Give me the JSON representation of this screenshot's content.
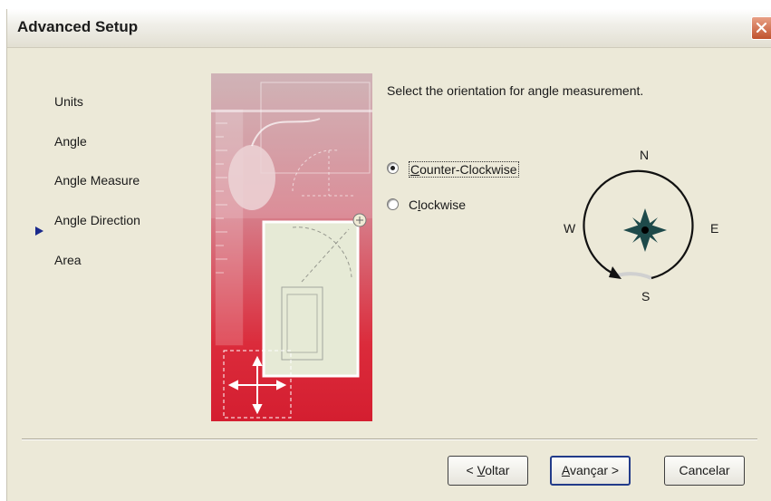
{
  "window": {
    "title": "Advanced Setup"
  },
  "steps": [
    {
      "label": "Units"
    },
    {
      "label": "Angle"
    },
    {
      "label": "Angle Measure"
    },
    {
      "label": "Angle Direction",
      "current": true
    },
    {
      "label": "Area"
    }
  ],
  "content": {
    "prompt": "Select the orientation for angle measurement.",
    "options": [
      {
        "label": "Counter-Clockwise",
        "mnemonic": "C",
        "rest": "ounter-Clockwise",
        "selected": true
      },
      {
        "label": "Clockwise",
        "mnemonic": "l",
        "pre": "C",
        "rest": "ockwise",
        "selected": false
      }
    ]
  },
  "compass": {
    "north": "N",
    "south": "S",
    "east": "E",
    "west": "W"
  },
  "buttons": {
    "back": {
      "label": "< Voltar",
      "pre": "< ",
      "mnemonic": "V",
      "rest": "oltar"
    },
    "next": {
      "label": "Avançar >",
      "mnemonic": "A",
      "rest": "vançar >"
    },
    "cancel": {
      "label": "Cancelar"
    }
  },
  "colors": {
    "accent": "#1a2a8c",
    "compass_star": "#1e4a4a",
    "illustration_red": "#d41e30"
  }
}
